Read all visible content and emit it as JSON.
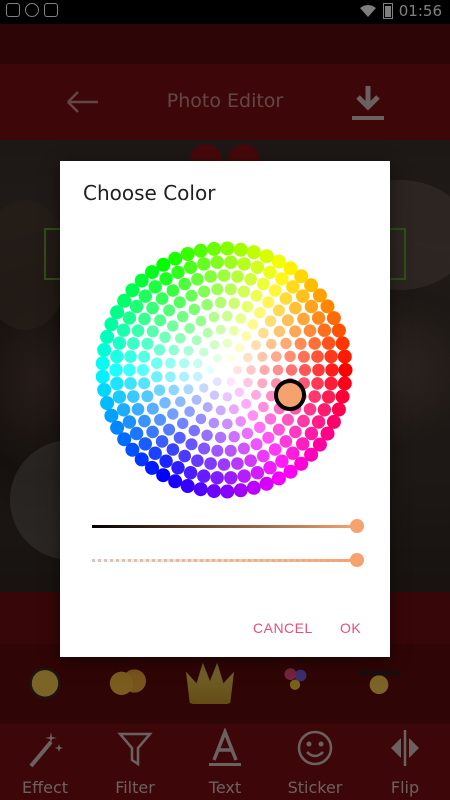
{
  "status_bar": {
    "time": "01:56",
    "icons": [
      "image-icon",
      "whatsapp-icon",
      "shield-icon",
      "wifi-icon",
      "battery-icon"
    ]
  },
  "toolbar": {
    "title": "Photo Editor",
    "back_icon": "arrow-left-icon",
    "download_icon": "download-icon"
  },
  "dialog": {
    "title": "Choose Color",
    "brightness_level": 1.0,
    "opacity_level": 1.0,
    "selected_color": "#f5a26f",
    "cancel_label": "CANCEL",
    "ok_label": "OK",
    "accent_color": "#ea4d7a"
  },
  "stickers": [
    "girl-emoji",
    "kissing-emoji-pair",
    "crown-sticker",
    "balloons-sticker",
    "graduate-emoji"
  ],
  "bottom_tabs": [
    {
      "label": "Effect",
      "icon": "magic-wand-icon"
    },
    {
      "label": "Filter",
      "icon": "funnel-icon"
    },
    {
      "label": "Text",
      "icon": "text-format-icon"
    },
    {
      "label": "Sticker",
      "icon": "smiley-icon"
    },
    {
      "label": "Flip",
      "icon": "flip-icon"
    }
  ],
  "colors": {
    "toolbar": "#7a0f12",
    "dialog_bg": "#ffffff",
    "accent": "#ea4d7a"
  }
}
